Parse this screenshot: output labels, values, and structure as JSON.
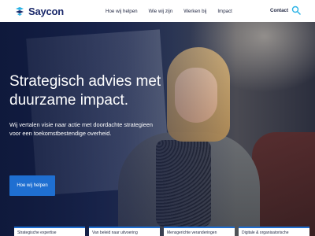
{
  "header": {
    "logo_text": "Saycon",
    "nav": [
      "Hoe wij helpen",
      "Wie wij zijn",
      "Werken bij",
      "Impact"
    ],
    "contact": "Contact",
    "search_icon": "search-icon"
  },
  "hero": {
    "title_line1": "Strategisch advies met",
    "title_line2": "duurzame impact.",
    "subtitle_line1": "Wij vertalen visie naar actie met doordachte strategieen",
    "subtitle_line2": "voor een toekomstbestendige overheid.",
    "cta": "Hoe wij helpen"
  },
  "cards": [
    "Strategische expertise",
    "Van beleid naar uitvoering",
    "Mensgerichte veranderingen",
    "Digitale & organisatorische"
  ],
  "colors": {
    "brand_navy": "#1c2a6b",
    "accent_blue": "#1f6fd1",
    "logo_cyan": "#2bb3e6"
  }
}
